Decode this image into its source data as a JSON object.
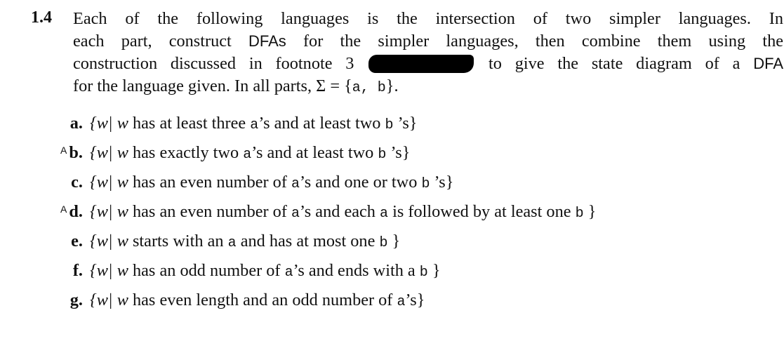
{
  "problem": {
    "number": "1.4",
    "intro_lines": [
      "Each of the following languages is the intersection of two simpler languages. In",
      "each part, construct",
      "for the simpler languages, then combine them using the",
      "construction discussed in footnote 3",
      "to give the state diagram of a",
      "for the language given. In all parts, Σ = {",
      "}."
    ],
    "dfa_term": "DFAs",
    "dfa_term_singular": "DFA",
    "sigma_symbols": "a, b",
    "redaction_note": "redacted"
  },
  "items": [
    {
      "label": "a.",
      "marker": "",
      "text": "w has at least three",
      "sym1": "a",
      "mid": "’s and at least two",
      "sym2": "b",
      "end": "’s}"
    },
    {
      "label": "b.",
      "marker": "A",
      "text": "w has exactly two",
      "sym1": "a",
      "mid": "’s and at least two",
      "sym2": "b",
      "end": "’s}"
    },
    {
      "label": "c.",
      "marker": "",
      "text": "w has an even number of",
      "sym1": "a",
      "mid": "’s and one or two",
      "sym2": "b",
      "end": "’s}"
    },
    {
      "label": "d.",
      "marker": "A",
      "text": "w has an even number of",
      "sym1": "a",
      "mid": "’s and each",
      "sym2": "a",
      "mid2": "is followed by at least one",
      "sym3": "b",
      "end": "}"
    },
    {
      "label": "e.",
      "marker": "",
      "text": "w starts with an",
      "sym1": "a",
      "mid": "and has at most one",
      "sym2": "b",
      "end": "}"
    },
    {
      "label": "f.",
      "marker": "",
      "text": "w has an odd number of",
      "sym1": "a",
      "mid": "’s and ends with a",
      "sym2": "b",
      "end": "}"
    },
    {
      "label": "g.",
      "marker": "",
      "text": "w has even length and an odd number of",
      "sym1": "a",
      "mid": "’s}",
      "sym2": "",
      "end": ""
    }
  ],
  "set_prefix": "{w|"
}
